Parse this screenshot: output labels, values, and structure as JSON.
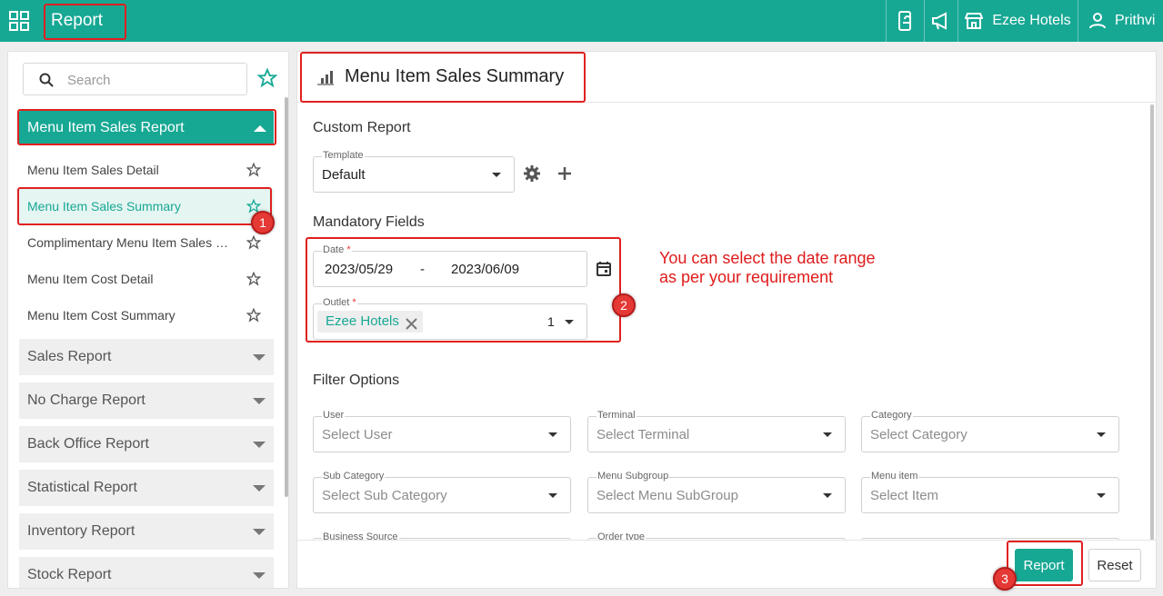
{
  "topbar": {
    "title": "Report",
    "property_label": "Ezee Hotels",
    "user_label": "Prithvi",
    "icons": [
      "apps-grid-icon",
      "mobile-order-icon",
      "megaphone-icon",
      "store-icon",
      "person-icon"
    ]
  },
  "sidebar": {
    "search_placeholder": "Search",
    "open_section": "Menu Item Sales Report",
    "sub_items": [
      {
        "label": "Menu Item Sales Detail"
      },
      {
        "label": "Menu Item Sales Summary"
      },
      {
        "label": "Complimentary Menu Item Sales D..."
      },
      {
        "label": "Menu Item Cost Detail"
      },
      {
        "label": "Menu Item Cost Summary"
      }
    ],
    "sections": [
      {
        "label": "Sales Report"
      },
      {
        "label": "No Charge Report"
      },
      {
        "label": "Back Office Report"
      },
      {
        "label": "Statistical Report"
      },
      {
        "label": "Inventory Report"
      },
      {
        "label": "Stock Report"
      }
    ]
  },
  "main": {
    "title": "Menu Item Sales Summary",
    "custom_report": {
      "heading": "Custom Report",
      "template_label": "Template",
      "template_value": "Default"
    },
    "mandatory": {
      "heading": "Mandatory Fields",
      "date_label": "Date",
      "date_from": "2023/05/29",
      "date_sep": "-",
      "date_to": "2023/06/09",
      "outlet_label": "Outlet",
      "outlet_chip": "Ezee Hotels",
      "outlet_count": "1"
    },
    "filters": {
      "heading": "Filter Options",
      "fields": [
        {
          "label": "User",
          "placeholder": "Select User"
        },
        {
          "label": "Terminal",
          "placeholder": "Select Terminal"
        },
        {
          "label": "Category",
          "placeholder": "Select Category"
        },
        {
          "label": "Sub Category",
          "placeholder": "Select Sub Category"
        },
        {
          "label": "Menu Subgroup",
          "placeholder": "Select Menu SubGroup"
        },
        {
          "label": "Menu item",
          "placeholder": "Select Item"
        },
        {
          "label": "Business Source"
        },
        {
          "label": "Order type"
        }
      ]
    },
    "buttons": {
      "report": "Report",
      "reset": "Reset"
    }
  },
  "annotations": {
    "note_line1": "You can select the date range",
    "note_line2": "as per your requirement",
    "badge1": "1",
    "badge2": "2",
    "badge3": "3"
  },
  "colors": {
    "accent": "#17a894",
    "highlight": "#e02020"
  }
}
